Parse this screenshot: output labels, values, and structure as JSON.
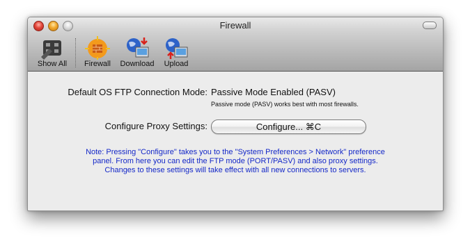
{
  "window": {
    "title": "Firewall",
    "toolbar": [
      {
        "label": "Show All",
        "icon": "show-all-icon"
      },
      {
        "label": "Firewall",
        "icon": "firewall-icon"
      },
      {
        "label": "Download",
        "icon": "download-icon"
      },
      {
        "label": "Upload",
        "icon": "upload-icon"
      }
    ]
  },
  "settings": {
    "mode_label": "Default OS FTP Connection Mode:",
    "mode_value": "Passive Mode Enabled (PASV)",
    "mode_hint": "Passive mode (PASV) works best with most firewalls.",
    "proxy_label": "Configure Proxy Settings:",
    "configure_button": "Configure... ⌘C",
    "note": "Note: Pressing \"Configure\" takes you to the \"System Preferences > Network\" preference panel. From here you can edit the FTP mode (PORT/PASV) and also proxy settings. Changes to these settings will take effect with all new connections to servers."
  },
  "colors": {
    "note_text": "#1428c8",
    "window_bg": "#ececec"
  }
}
